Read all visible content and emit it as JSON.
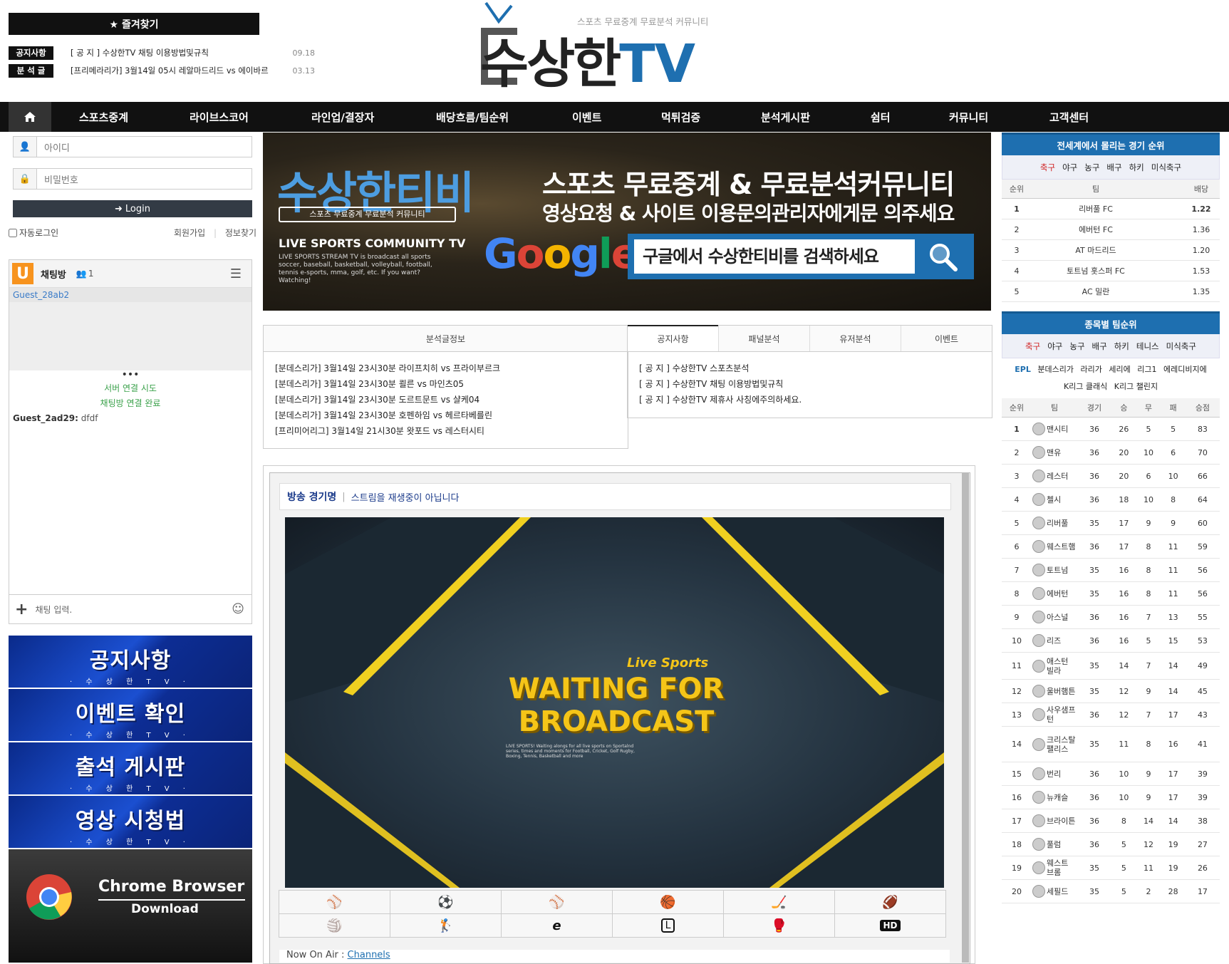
{
  "header": {
    "favorites": "★ 즐겨찾기",
    "notices": [
      {
        "tag": "공지사항",
        "text": "[ 공 지 ] 수상한TV 채팅 이용방법및규칙",
        "date": "09.18"
      },
      {
        "tag": "분 석 글",
        "text": "[프리메라리가] 3월14일 05시 레알마드리드 vs 에이바르",
        "date": "03.13"
      }
    ],
    "logo_tagline": "스포츠 무료중계 무료분석 커뮤니티",
    "logo_main": "수상한",
    "logo_tv": "TV"
  },
  "nav": {
    "items": [
      "스포츠중계",
      "라이브스코어",
      "라인업/결장자",
      "배당흐름/팀순위",
      "이벤트",
      "먹튀검증",
      "분석게시판",
      "쉼터",
      "커뮤니티",
      "고객센터"
    ]
  },
  "login": {
    "id_placeholder": "아이디",
    "pw_placeholder": "비밀번호",
    "button": "Login",
    "auto_login": "자동로그인",
    "join": "회원가입",
    "find": "정보찾기"
  },
  "chat": {
    "title": "채팅방",
    "count": "1",
    "current_user": "Guest_28ab2",
    "status1": "서버 연결 시도",
    "status2": "채팅방 연결 완료",
    "msg_user": "Guest_2ad29:",
    "msg_text": "dfdf",
    "input_placeholder": "채팅 입력."
  },
  "side_banners": [
    {
      "big": "공지사항",
      "small": "· 수 상 한 T V ·"
    },
    {
      "big": "이벤트 확인",
      "small": "· 수 상 한 T V ·"
    },
    {
      "big": "출석 게시판",
      "small": "· 수 상 한 T V ·"
    },
    {
      "big": "영상 시청법",
      "small": "· 수 상 한 T V ·"
    }
  ],
  "chrome_banner": {
    "line1": "Chrome Browser",
    "line2": "Download"
  },
  "hero": {
    "brand": "수상한티비",
    "brand_sub": "스포츠 무료중계 무료분석 커뮤니티",
    "live": "LIVE SPORTS COMMUNITY TV",
    "live_desc": "LIVE SPORTS STREAM TV is broadcast all sports soccer, baseball, basketball, volleyball, football, tennis e-sports, mma, golf, etc. If you want? Watching!",
    "headline1": "스포츠 무료중계 & 무료분석커뮤니티",
    "headline2": "영상요청 & 사이트 이용문의관리자에게문 의주세요",
    "google": "Google",
    "search_text": "구글에서 수상한티비를 검색하세요"
  },
  "tabs_left": {
    "title": "분석글정보",
    "items": [
      "[분데스리가] 3월14일 23시30분 라이프치히 vs 프라이부르크",
      "[분데스리가] 3월14일 23시30분 쾰른 vs 마인츠05",
      "[분데스리가] 3월14일 23시30분 도르트문트 vs 샬케04",
      "[분데스리가] 3월14일 23시30분 호펜하임 vs 헤르타베를린",
      "[프리미어리그] 3월14일 21시30분 왓포드 vs 레스터시티"
    ]
  },
  "tabs_right": {
    "tabs": [
      "공지사항",
      "패널분석",
      "유저분석",
      "이벤트"
    ],
    "items": [
      "[ 공 지 ] 수상한TV 스포츠분석",
      "[ 공 지 ] 수상한TV 채팅 이용방법및규칙",
      "[ 공 지 ] 수상한TV 제휴사 사칭에주의하세요."
    ]
  },
  "player": {
    "label": "방송 경기명",
    "status": "스트림을 재생중이 아닙니다",
    "live_sports": "Live Sports",
    "waiting1": "WAITING FOR",
    "waiting2": "BROADCAST",
    "waiting_desc": "LIVE SPORTS! Waiting alongs for all live sports on Sportalnd series, times and moments for Football, Cricket, Golf Rugby, Boxing, Tennis, Basketball and more",
    "icons": [
      "⚾",
      "⚽",
      "⚾",
      "🏀",
      "🏒",
      "🏈",
      "🏐",
      "🏌",
      "e",
      "L",
      "🥊",
      "HD"
    ],
    "now_on_air": "Now On Air : ",
    "channels": "Channels"
  },
  "odds": {
    "title": "전세계에서 몰리는 경기 순위",
    "tabs": [
      "축구",
      "야구",
      "농구",
      "배구",
      "하키",
      "미식축구"
    ],
    "headers": [
      "순위",
      "팀",
      "배당"
    ],
    "rows": [
      {
        "rank": "1",
        "team": "리버풀 FC",
        "odds": "1.22"
      },
      {
        "rank": "2",
        "team": "에버턴 FC",
        "odds": "1.36"
      },
      {
        "rank": "3",
        "team": "AT 마드리드",
        "odds": "1.20"
      },
      {
        "rank": "4",
        "team": "토트넘 홋스퍼 FC",
        "odds": "1.53"
      },
      {
        "rank": "5",
        "team": "AC 밀란",
        "odds": "1.35"
      }
    ]
  },
  "standings": {
    "title": "종목별 팀순위",
    "tabs": [
      "축구",
      "야구",
      "농구",
      "배구",
      "하키",
      "테니스",
      "미식축구"
    ],
    "leagues1": [
      "EPL",
      "분데스리가",
      "라리가",
      "세리에",
      "리그1",
      "에레디비지에"
    ],
    "leagues2": [
      "K리그 클래식",
      "K리그 챌린지"
    ],
    "headers": [
      "순위",
      "팀",
      "경기",
      "승",
      "무",
      "패",
      "승점"
    ],
    "rows": [
      {
        "rank": "1",
        "team": "맨시티",
        "p": "36",
        "w": "26",
        "d": "5",
        "l": "5",
        "pts": "83"
      },
      {
        "rank": "2",
        "team": "맨유",
        "p": "36",
        "w": "20",
        "d": "10",
        "l": "6",
        "pts": "70"
      },
      {
        "rank": "3",
        "team": "레스터",
        "p": "36",
        "w": "20",
        "d": "6",
        "l": "10",
        "pts": "66"
      },
      {
        "rank": "4",
        "team": "첼시",
        "p": "36",
        "w": "18",
        "d": "10",
        "l": "8",
        "pts": "64"
      },
      {
        "rank": "5",
        "team": "리버풀",
        "p": "35",
        "w": "17",
        "d": "9",
        "l": "9",
        "pts": "60"
      },
      {
        "rank": "6",
        "team": "웨스트햄",
        "p": "36",
        "w": "17",
        "d": "8",
        "l": "11",
        "pts": "59"
      },
      {
        "rank": "7",
        "team": "토트넘",
        "p": "35",
        "w": "16",
        "d": "8",
        "l": "11",
        "pts": "56"
      },
      {
        "rank": "8",
        "team": "에버턴",
        "p": "35",
        "w": "16",
        "d": "8",
        "l": "11",
        "pts": "56"
      },
      {
        "rank": "9",
        "team": "아스널",
        "p": "36",
        "w": "16",
        "d": "7",
        "l": "13",
        "pts": "55"
      },
      {
        "rank": "10",
        "team": "리즈",
        "p": "36",
        "w": "16",
        "d": "5",
        "l": "15",
        "pts": "53"
      },
      {
        "rank": "11",
        "team": "애스턴 빌라",
        "p": "35",
        "w": "14",
        "d": "7",
        "l": "14",
        "pts": "49"
      },
      {
        "rank": "12",
        "team": "울버햄튼",
        "p": "35",
        "w": "12",
        "d": "9",
        "l": "14",
        "pts": "45"
      },
      {
        "rank": "13",
        "team": "사우샘프턴",
        "p": "36",
        "w": "12",
        "d": "7",
        "l": "17",
        "pts": "43"
      },
      {
        "rank": "14",
        "team": "크리스탈 팰리스",
        "p": "35",
        "w": "11",
        "d": "8",
        "l": "16",
        "pts": "41"
      },
      {
        "rank": "15",
        "team": "번리",
        "p": "36",
        "w": "10",
        "d": "9",
        "l": "17",
        "pts": "39"
      },
      {
        "rank": "16",
        "team": "뉴캐슬",
        "p": "36",
        "w": "10",
        "d": "9",
        "l": "17",
        "pts": "39"
      },
      {
        "rank": "17",
        "team": "브라이튼",
        "p": "36",
        "w": "8",
        "d": "14",
        "l": "14",
        "pts": "38"
      },
      {
        "rank": "18",
        "team": "풀럼",
        "p": "36",
        "w": "5",
        "d": "12",
        "l": "19",
        "pts": "27"
      },
      {
        "rank": "19",
        "team": "웨스트 브롬",
        "p": "35",
        "w": "5",
        "d": "11",
        "l": "19",
        "pts": "26"
      },
      {
        "rank": "20",
        "team": "세필드",
        "p": "35",
        "w": "5",
        "d": "2",
        "l": "28",
        "pts": "17"
      }
    ]
  },
  "colors": {
    "accent": "#1e6fb0",
    "nav_bg": "#111111",
    "active_tab": "#d02020"
  }
}
